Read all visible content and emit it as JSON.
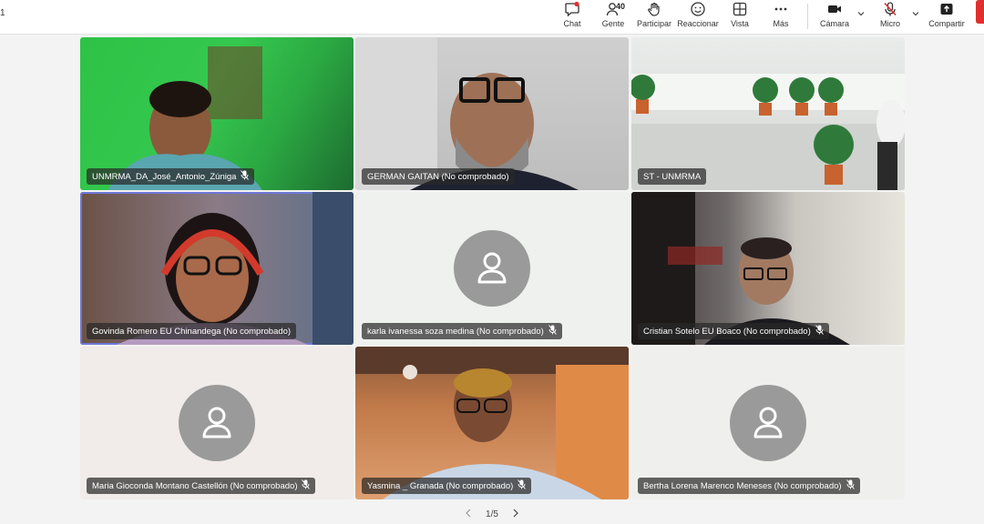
{
  "window": {
    "page_indicator": "1"
  },
  "toolbar": {
    "chat": "Chat",
    "participants": "Gente",
    "participants_count": "40",
    "raise_hand": "Participar",
    "react": "Reaccionar",
    "view": "Vista",
    "more": "Más",
    "camera": "Cámara",
    "mic": "Micro",
    "share": "Compartir"
  },
  "participants": [
    {
      "name": "UNMRMA_DA_José_Antonio_Zúniga",
      "muted": true,
      "video": true
    },
    {
      "name": "GERMAN GAITAN (No comprobado)",
      "muted": false,
      "video": true
    },
    {
      "name": "ST - UNMRMA",
      "muted": false,
      "video": true
    },
    {
      "name": "Govinda Romero EU Chinandega (No comprobado)",
      "muted": false,
      "video": true,
      "active_speaker": true
    },
    {
      "name": "karla ivanessa soza medina (No comprobado)",
      "muted": true,
      "video": false
    },
    {
      "name": "Cristian Sotelo EU Boaco (No comprobado)",
      "muted": true,
      "video": true
    },
    {
      "name": "Maria Gioconda Montano Castellón (No comprobado)",
      "muted": true,
      "video": false
    },
    {
      "name": "Yasmina _ Granada (No comprobado)",
      "muted": true,
      "video": true
    },
    {
      "name": "Bertha Lorena Marenco Meneses (No comprobado)",
      "muted": true,
      "video": false
    }
  ],
  "pager": {
    "label": "1/5"
  },
  "icons": {
    "chat": "chat-bubble-icon",
    "participants": "people-icon",
    "raise_hand": "hand-icon",
    "react": "smiley-icon",
    "view": "grid-icon",
    "more": "ellipsis-icon",
    "camera": "video-camera-icon",
    "mic": "microphone-muted-icon",
    "share": "share-upload-icon"
  },
  "colors": {
    "active_speaker_border": "#6e78d8",
    "stop_button": "#e0302d",
    "avatar_bg": "#9a9a9a"
  }
}
